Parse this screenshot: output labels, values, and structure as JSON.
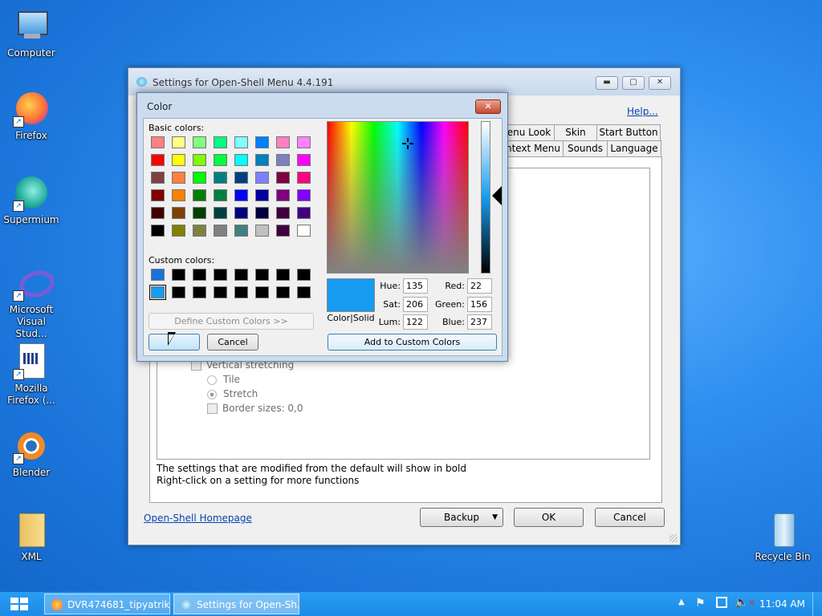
{
  "desktop": {
    "icons": [
      {
        "label": "Computer"
      },
      {
        "label": "Firefox"
      },
      {
        "label": "Supermium"
      },
      {
        "label": "Microsoft Visual Stud..."
      },
      {
        "label": "Mozilla Firefox (..."
      },
      {
        "label": "Blender"
      },
      {
        "label": "XML"
      },
      {
        "label": "Recycle Bin"
      }
    ]
  },
  "settings_window": {
    "title": "Settings for Open-Shell Menu 4.4.191",
    "help_link": "Help...",
    "tabs_row1": [
      "enu Look",
      "Skin",
      "Start Button"
    ],
    "tabs_row2": [
      "ntext Menu",
      "Sounds",
      "Language"
    ],
    "tree": {
      "vertical_stretching": "Vertical stretching",
      "tile": "Tile",
      "stretch": "Stretch",
      "border_sizes": "Border sizes: 0,0"
    },
    "hint1": "The settings that are modified from the default will show in bold",
    "hint2": "Right-click on a setting for more functions",
    "homepage_link": "Open-Shell Homepage",
    "backup_label": "Backup",
    "ok_label": "OK",
    "cancel_label": "Cancel"
  },
  "color_dialog": {
    "title": "Color",
    "basic_colors_label": "Basic colors:",
    "custom_colors_label": "Custom colors:",
    "define_custom_label": "Define Custom Colors >>",
    "ok_label": "OK",
    "cancel_label": "Cancel",
    "color_solid_label": "Color|Solid",
    "add_custom_label": "Add to Custom Colors",
    "selected_color": "#169cf0",
    "fields": {
      "hue_label": "Hue:",
      "hue": "135",
      "sat_label": "Sat:",
      "sat": "206",
      "lum_label": "Lum:",
      "lum": "122",
      "red_label": "Red:",
      "red": "22",
      "green_label": "Green:",
      "green": "156",
      "blue_label": "Blue:",
      "blue": "237"
    },
    "basic_colors": [
      "#ff8080",
      "#ffff80",
      "#80ff80",
      "#00ff80",
      "#80ffff",
      "#0080ff",
      "#ff80c0",
      "#ff80ff",
      "#ff0000",
      "#ffff00",
      "#80ff00",
      "#00ff40",
      "#00ffff",
      "#0080c0",
      "#8080c0",
      "#ff00ff",
      "#804040",
      "#ff8040",
      "#00ff00",
      "#008080",
      "#004080",
      "#8080ff",
      "#800040",
      "#ff0080",
      "#800000",
      "#ff8000",
      "#008000",
      "#008040",
      "#0000ff",
      "#0000a0",
      "#800080",
      "#8000ff",
      "#400000",
      "#804000",
      "#004000",
      "#004040",
      "#000080",
      "#000040",
      "#400040",
      "#400080",
      "#000000",
      "#808000",
      "#808040",
      "#808080",
      "#408080",
      "#c0c0c0",
      "#400040",
      "#ffffff"
    ],
    "custom_colors": [
      "#1a73d8",
      "#000000",
      "#000000",
      "#000000",
      "#000000",
      "#000000",
      "#000000",
      "#000000",
      "#169cf0",
      "#000000",
      "#000000",
      "#000000",
      "#000000",
      "#000000",
      "#000000",
      "#000000"
    ]
  },
  "taskbar": {
    "items": [
      {
        "label": "DVR474681_tipyatrik..."
      },
      {
        "label": "Settings for Open-Sh..."
      }
    ],
    "clock": "11:04 AM"
  }
}
